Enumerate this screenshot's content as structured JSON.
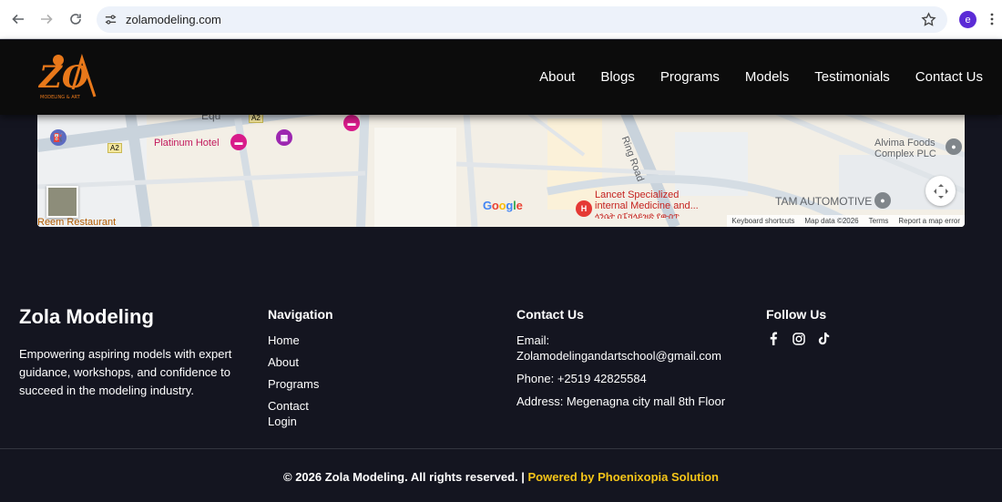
{
  "browser": {
    "url": "zolamodeling.com",
    "profile_initial": "e"
  },
  "header": {
    "logo_text": "ZOLA",
    "logo_subtext": "MODELING & ART SCHOOL",
    "nav": [
      "About",
      "Blogs",
      "Programs",
      "Models",
      "Testimonials",
      "Contact Us"
    ]
  },
  "map": {
    "labels": {
      "platinum": "Platinum Hotel",
      "ring": "Ring Road",
      "alvima1": "Alvima Foods",
      "alvima2": "Complex PLC",
      "lancet1": "Lancet Specialized",
      "lancet2": "internal Medicine and...",
      "lancet3": "ላንሴት ስፔሻላይዝድ የውስጥ",
      "tam": "TAM AUTOMOTIVE",
      "reem": "Reem Restaurant",
      "equ": "Equ",
      "a2a": "A2",
      "a2b": "A2"
    },
    "google": "Google",
    "attribution": [
      "Keyboard shortcuts",
      "Map data ©2026",
      "Terms",
      "Report a map error"
    ]
  },
  "footer": {
    "brand": {
      "title": "Zola Modeling",
      "description": "Empowering aspiring models with expert guidance, workshops, and confidence to succeed in the modeling industry."
    },
    "navigation": {
      "title": "Navigation",
      "items": [
        "Home",
        "About",
        "Programs",
        "Contact",
        "Login"
      ]
    },
    "contact": {
      "title": "Contact Us",
      "email_label": "Email:",
      "email": "Zolamodelingandartschool@gmail.com",
      "phone": "Phone: +2519 42825584",
      "address": "Address: Megenagna city mall 8th Floor"
    },
    "follow": {
      "title": "Follow Us",
      "icons": [
        "facebook-icon",
        "instagram-icon",
        "tiktok-icon"
      ]
    },
    "copyright": "© 2026 Zola Modeling. All rights reserved. |",
    "powered": "Powered by Phoenixopia Solution"
  },
  "colors": {
    "footer_bg": "#141520",
    "header_bg": "#0c0c0c",
    "accent": "#f5c518",
    "logo": "#e8781a"
  }
}
